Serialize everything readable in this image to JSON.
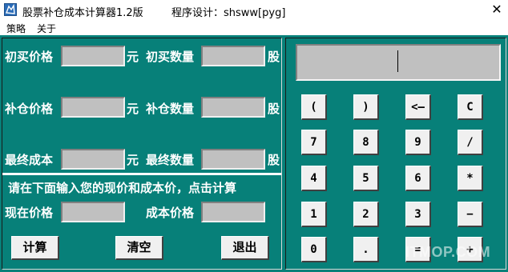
{
  "window": {
    "title": "股票补仓成本计算器1.2版",
    "subtitle": "程序设计：shsww[pyg]",
    "close_symbol": "✕"
  },
  "menu": {
    "items": [
      "策略",
      "关于"
    ]
  },
  "form": {
    "row1": {
      "label_left": "初买价格",
      "unit_left": "元",
      "label_right": "初买数量",
      "unit_right": "股",
      "value_left": "",
      "value_right": ""
    },
    "row2": {
      "label_left": "补仓价格",
      "unit_left": "元",
      "label_right": "补仓数量",
      "unit_right": "股",
      "value_left": "",
      "value_right": ""
    },
    "row3": {
      "label_left": "最终成本",
      "unit_left": "元",
      "label_right": "最终数量",
      "unit_right": "股",
      "value_left": "",
      "value_right": ""
    },
    "instruction": "请在下面输入您的现价和成本价，点击计算",
    "row4": {
      "label_left": "现在价格",
      "label_right": "成本价格",
      "value_left": "",
      "value_right": ""
    }
  },
  "buttons": {
    "calc": "计算",
    "clear": "清空",
    "exit": "退出"
  },
  "calculator": {
    "display_value": "",
    "keys": [
      [
        "(",
        ")",
        "<—",
        "C"
      ],
      [
        "7",
        "8",
        "9",
        "/"
      ],
      [
        "4",
        "5",
        "6",
        "*"
      ],
      [
        "1",
        "2",
        "3",
        "−"
      ],
      [
        "0",
        ".",
        "=",
        "+"
      ]
    ]
  },
  "watermark": "ITMOP.COM",
  "colors": {
    "client_bg": "#078079",
    "field_bg": "#c0c0c0",
    "button_bg": "#f0f0f0"
  }
}
